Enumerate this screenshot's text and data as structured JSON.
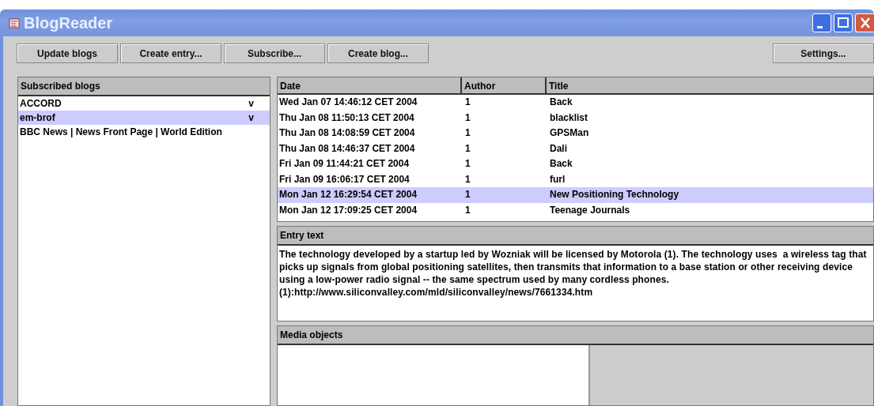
{
  "window": {
    "title": "BlogReader"
  },
  "toolbar": {
    "buttons": [
      "Update blogs",
      "Create entry...",
      "Subscribe...",
      "Create blog..."
    ],
    "settings": "Settings..."
  },
  "blogs": {
    "header": "Subscribed blogs",
    "items": [
      {
        "name": "ACCORD",
        "mark": "v",
        "selected": false
      },
      {
        "name": "em-brof",
        "mark": "v",
        "selected": true
      },
      {
        "name": "BBC News | News Front Page | World Edition",
        "selected": false
      }
    ]
  },
  "entries": {
    "columns": [
      "Date",
      "Author",
      "Title"
    ],
    "rows": [
      {
        "date": "Wed Jan 07 14:46:12 CET 2004",
        "author": "1",
        "title": "Back",
        "selected": false
      },
      {
        "date": "Thu Jan 08 11:50:13 CET 2004",
        "author": "1",
        "title": "blacklist",
        "selected": false
      },
      {
        "date": "Thu Jan 08 14:08:59 CET 2004",
        "author": "1",
        "title": "GPSMan",
        "selected": false
      },
      {
        "date": "Thu Jan 08 14:46:37 CET 2004",
        "author": "1",
        "title": "Dali",
        "selected": false
      },
      {
        "date": "Fri Jan 09 11:44:21 CET 2004",
        "author": "1",
        "title": "Back",
        "selected": false
      },
      {
        "date": "Fri Jan 09 16:06:17 CET 2004",
        "author": "1",
        "title": "furl",
        "selected": false
      },
      {
        "date": "Mon Jan 12 16:29:54 CET 2004",
        "author": "1",
        "title": "New Positioning Technology",
        "selected": true
      },
      {
        "date": "Mon Jan 12 17:09:25 CET 2004",
        "author": "1",
        "title": "Teenage Journals",
        "selected": false
      }
    ]
  },
  "entry_text": {
    "header": "Entry text",
    "text": "The technology developed by a startup led by Wozniak will be licensed by Motorola (1). The technology uses  a wireless tag that picks up signals from global positioning satellites, then transmits that information to a base station or other receiving device using a low-power radio signal -- the same spectrum used by many cordless phones.\n(1):http://www.siliconvalley.com/mld/siliconvalley/news/7661334.htm"
  },
  "media": {
    "header": "Media objects"
  }
}
